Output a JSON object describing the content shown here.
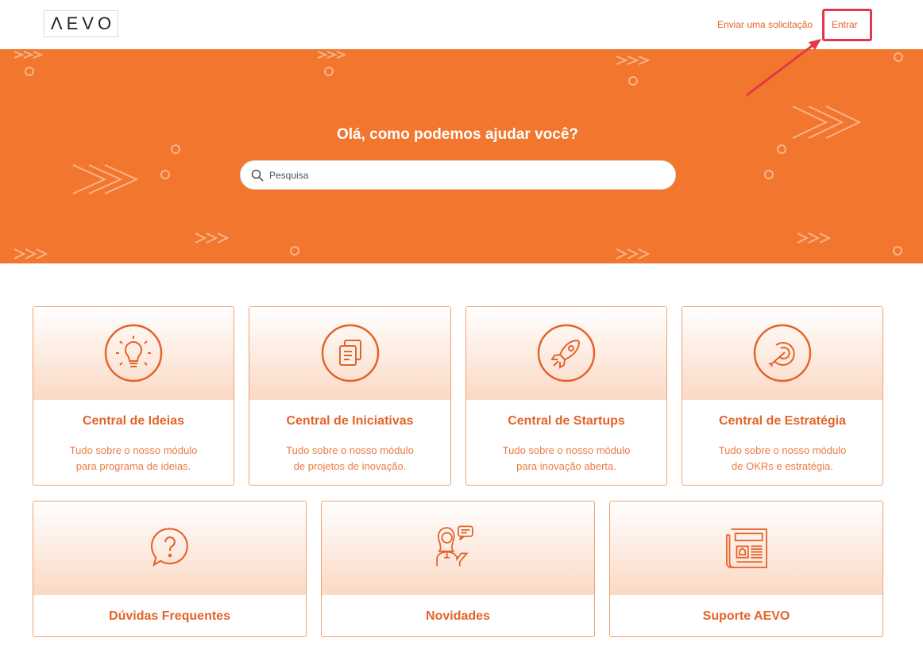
{
  "header": {
    "logo_text": "ΛEVO",
    "nav": {
      "request_label": "Enviar uma solicitação",
      "login_label": "Entrar"
    }
  },
  "hero": {
    "title": "Olá, como podemos ajudar você?",
    "search_placeholder": "Pesquisa"
  },
  "cards_row1": [
    {
      "title": "Central de Ideias",
      "desc_line1": "Tudo sobre o nosso módulo",
      "desc_line2": "para programa de ideias.",
      "icon": "lightbulb-icon"
    },
    {
      "title": "Central de Iniciativas",
      "desc_line1": "Tudo sobre o nosso módulo",
      "desc_line2": "de projetos de inovação.",
      "icon": "documents-icon"
    },
    {
      "title": "Central de Startups",
      "desc_line1": "Tudo sobre o nosso módulo",
      "desc_line2": "para inovação aberta.",
      "icon": "rocket-icon"
    },
    {
      "title": "Central de Estratégia",
      "desc_line1": "Tudo sobre o nosso módulo",
      "desc_line2": "de OKRs e estratégia.",
      "icon": "target-dart-icon"
    }
  ],
  "cards_row2": [
    {
      "title": "Dúvidas Frequentes",
      "icon": "question-bubble-icon"
    },
    {
      "title": "Novidades",
      "icon": "presenter-chat-icon"
    },
    {
      "title": "Suporte AEVO",
      "icon": "newspaper-icon"
    }
  ],
  "colors": {
    "brand_orange": "#f2762e",
    "text_orange": "#e5632a",
    "highlight_red": "#e2394a"
  }
}
